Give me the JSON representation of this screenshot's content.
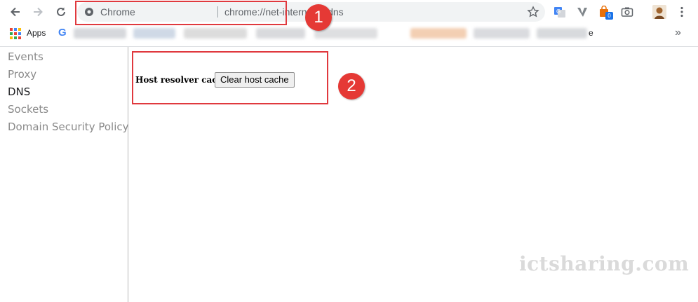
{
  "toolbar": {
    "back_icon": "arrow-left-icon",
    "forward_icon": "arrow-right-icon",
    "reload_icon": "reload-icon",
    "omnibox": {
      "site_label": "Chrome",
      "url": "chrome://net-internals/#dns",
      "site_icon": "chrome-info-icon",
      "bookmark_icon": "star-icon"
    },
    "extensions": [
      {
        "name": "translate-icon"
      },
      {
        "name": "vivaldi-v-icon"
      },
      {
        "name": "shopping-bag-icon",
        "badge": "0"
      },
      {
        "name": "camera-icon"
      },
      {
        "name": "profile-avatar-icon"
      }
    ],
    "menu_icon": "vertical-dots-menu-icon"
  },
  "bookmarks": {
    "apps_label": "Apps",
    "google_letter": "G",
    "tail_text": "e",
    "overflow_label": "»"
  },
  "sidebar": {
    "items": [
      {
        "label": "Events",
        "active": false
      },
      {
        "label": "Proxy",
        "active": false
      },
      {
        "label": "DNS",
        "active": true
      },
      {
        "label": "Sockets",
        "active": false
      },
      {
        "label": "Domain Security Policy",
        "active": false
      }
    ]
  },
  "dns": {
    "cache_label": "Host resolver cache",
    "clear_button_label": "Clear host cache"
  },
  "annotations": {
    "step1": "1",
    "step2": "2",
    "color": "#e53935"
  },
  "watermark": "ictsharing.com"
}
